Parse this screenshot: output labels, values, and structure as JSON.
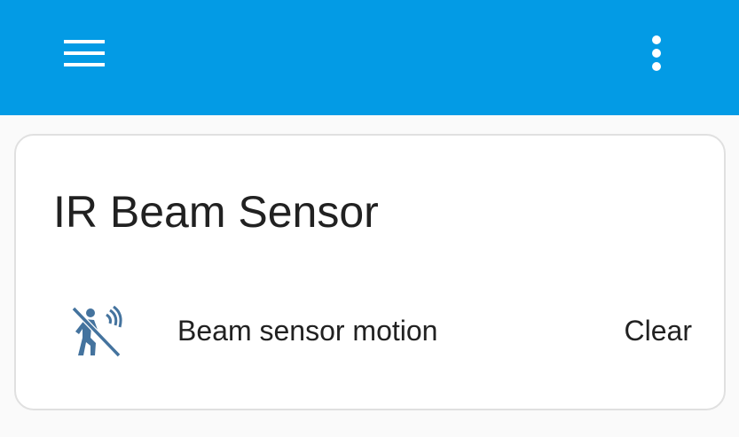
{
  "header": {
    "background_color": "#039be5",
    "menu_icon": "hamburger-menu-icon",
    "overflow_icon": "dots-vertical-icon"
  },
  "card": {
    "title": "IR Beam Sensor",
    "entities": [
      {
        "icon": "motion-sensor-off-icon",
        "icon_color": "#44739e",
        "name": "Beam sensor motion",
        "state": "Clear"
      }
    ]
  }
}
